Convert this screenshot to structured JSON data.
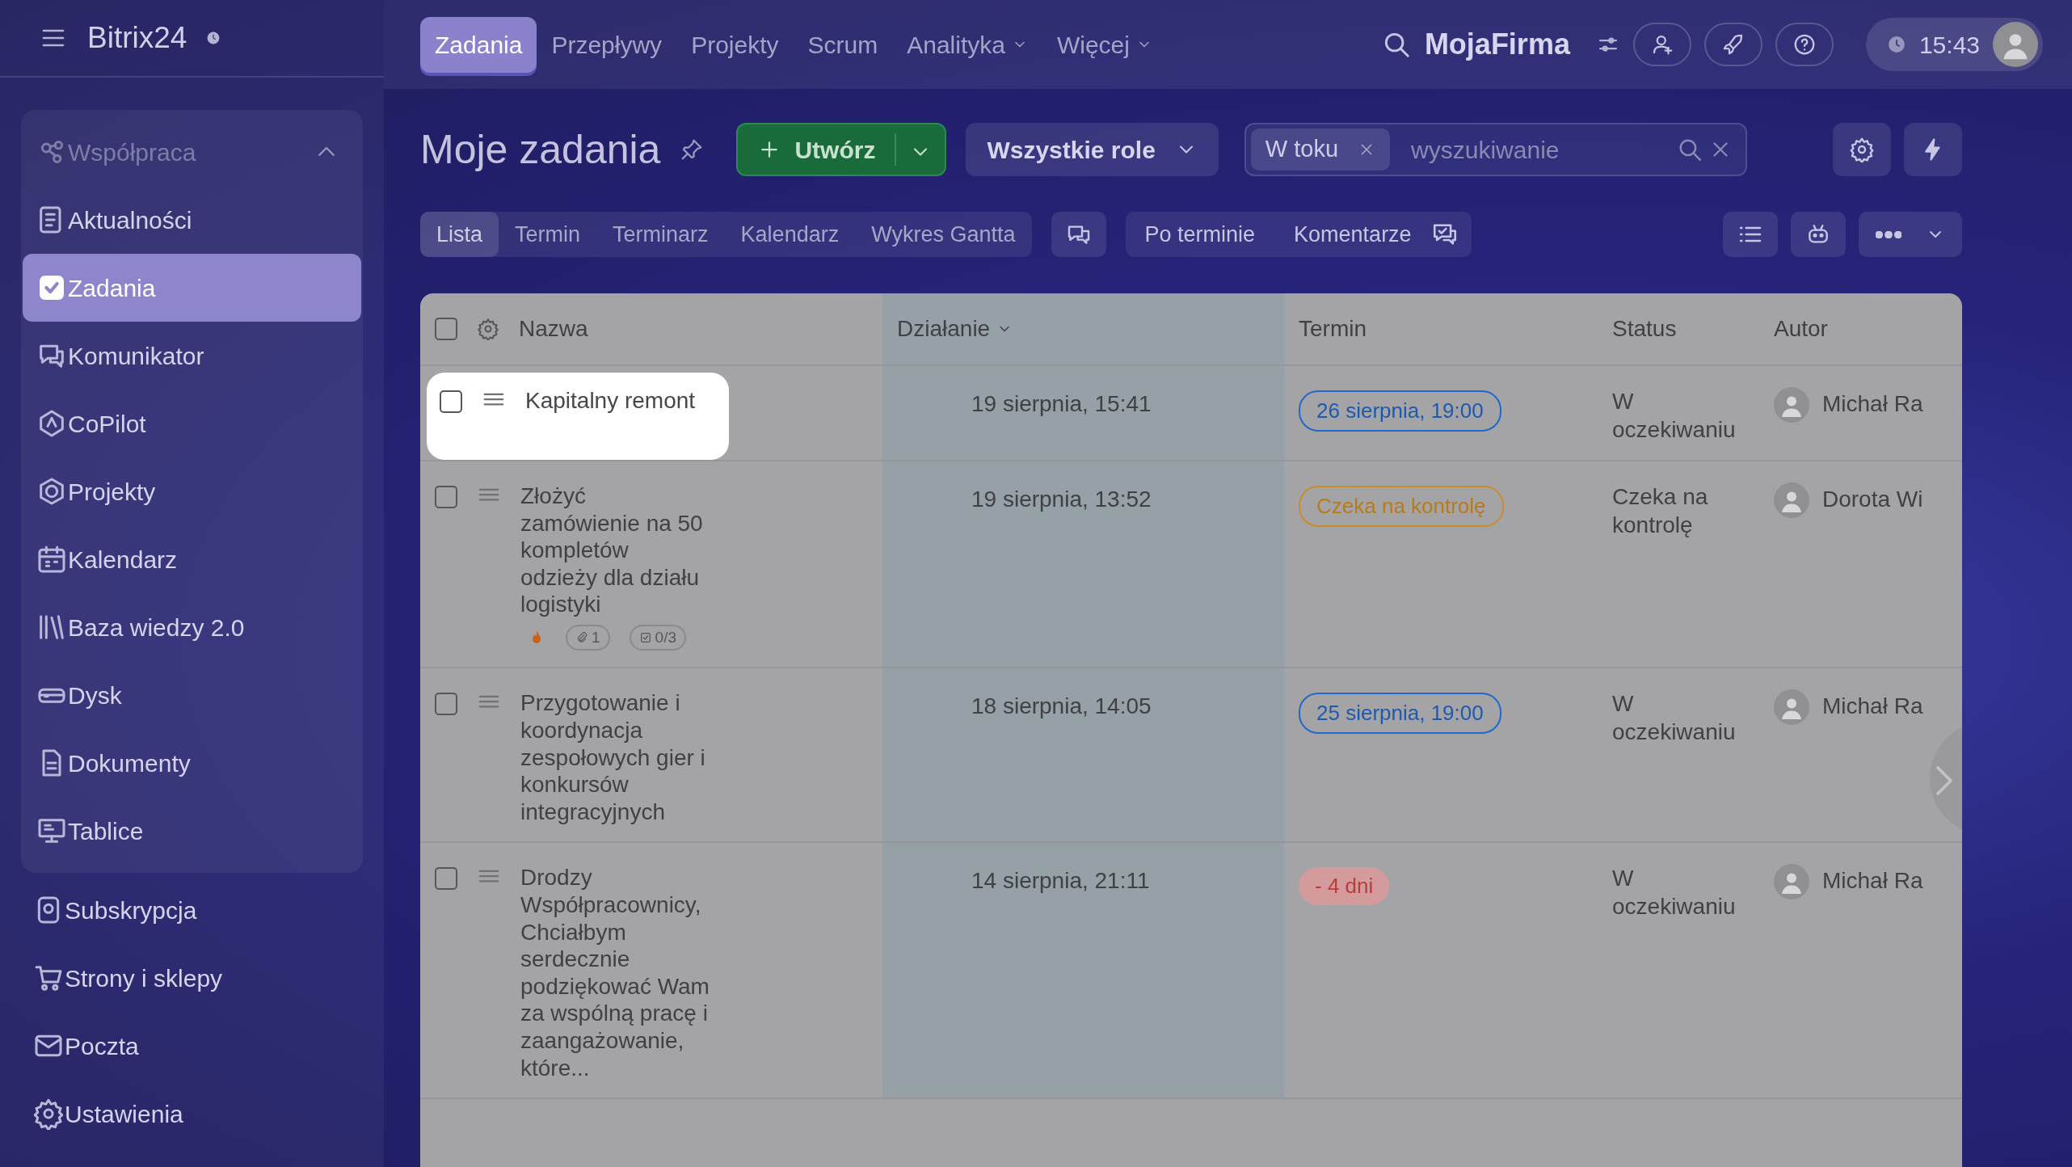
{
  "sidebar": {
    "logo": "Bitrix24",
    "group": {
      "label": "Współpraca",
      "expanded": true,
      "items": [
        {
          "label": "Aktualności",
          "selected": false
        },
        {
          "label": "Zadania",
          "selected": true
        },
        {
          "label": "Komunikator",
          "selected": false
        },
        {
          "label": "CoPilot",
          "selected": false
        },
        {
          "label": "Projekty",
          "selected": false
        },
        {
          "label": "Kalendarz",
          "selected": false
        },
        {
          "label": "Baza wiedzy 2.0",
          "selected": false
        },
        {
          "label": "Dysk",
          "selected": false
        },
        {
          "label": "Dokumenty",
          "selected": false
        },
        {
          "label": "Tablice",
          "selected": false
        }
      ]
    },
    "items": [
      {
        "label": "Subskrypcja",
        "selected": false
      },
      {
        "label": "Strony i sklepy",
        "selected": false
      },
      {
        "label": "Poczta",
        "selected": false
      }
    ],
    "footer": "Ustawienia"
  },
  "top_nav": [
    {
      "label": "Zadania",
      "selected": true,
      "dropdown": false
    },
    {
      "label": "Przepływy",
      "selected": false,
      "dropdown": false
    },
    {
      "label": "Projekty",
      "selected": false,
      "dropdown": false
    },
    {
      "label": "Scrum",
      "selected": false,
      "dropdown": false
    },
    {
      "label": "Analityka",
      "selected": false,
      "dropdown": true
    },
    {
      "label": "Więcej",
      "selected": false,
      "dropdown": true
    }
  ],
  "company": "MojaFirma",
  "time": "15:43",
  "toolbar": {
    "title": "Moje zadania",
    "create": "Utwórz",
    "roles": "Wszystkie role",
    "filter_chip": "W toku",
    "search": {
      "placeholder": "wyszukiwanie"
    }
  },
  "view_tabs": [
    {
      "label": "Lista",
      "selected": true
    },
    {
      "label": "Termin",
      "selected": false
    },
    {
      "label": "Terminarz",
      "selected": false
    },
    {
      "label": "Kalendarz",
      "selected": false
    },
    {
      "label": "Wykres Gantta",
      "selected": false
    }
  ],
  "counters": [
    "Po terminie",
    "Komentarze"
  ],
  "table": {
    "select_all_checked": false,
    "columns": [
      "Nazwa",
      "Działanie",
      "Termin",
      "Status",
      "Autor"
    ],
    "rows": [
      {
        "name": "Kapitalny remont",
        "checked": false,
        "highlighted": true,
        "activity": "19 sierpnia, 15:41",
        "deadline": {
          "kind": "date",
          "text": "26 sierpnia, 19:00"
        },
        "status": "W oczekiwaniu",
        "author": "Michał Ra"
      },
      {
        "name": "Złożyć zamówienie na 50 kompletów odzieży dla działu logistyki",
        "checked": false,
        "highlighted": false,
        "activity": "19 sierpnia, 13:52",
        "deadline": {
          "kind": "waiting",
          "text": "Czeka na kontrolę"
        },
        "status": "Czeka na kontrolę",
        "author": "Dorota Wi",
        "meta": {
          "hot": true,
          "attachments": "1",
          "checklist": "0/3"
        }
      },
      {
        "name": "Przygotowanie i koordynacja zespołowych gier i konkursów integracyjnych",
        "checked": false,
        "highlighted": false,
        "activity": "18 sierpnia, 14:05",
        "deadline": {
          "kind": "date",
          "text": "25 sierpnia, 19:00"
        },
        "status": "W oczekiwaniu",
        "author": "Michał Ra"
      },
      {
        "name": "Drodzy Współpracownicy, Chciałbym serdecznie podziękować Wam za wspólną pracę i zaangażowanie, które...",
        "checked": false,
        "highlighted": false,
        "activity": "14 sierpnia, 21:11",
        "deadline": {
          "kind": "overdue",
          "text": "- 4 dni"
        },
        "status": "W oczekiwaniu",
        "author": "Michał Ra"
      }
    ]
  }
}
